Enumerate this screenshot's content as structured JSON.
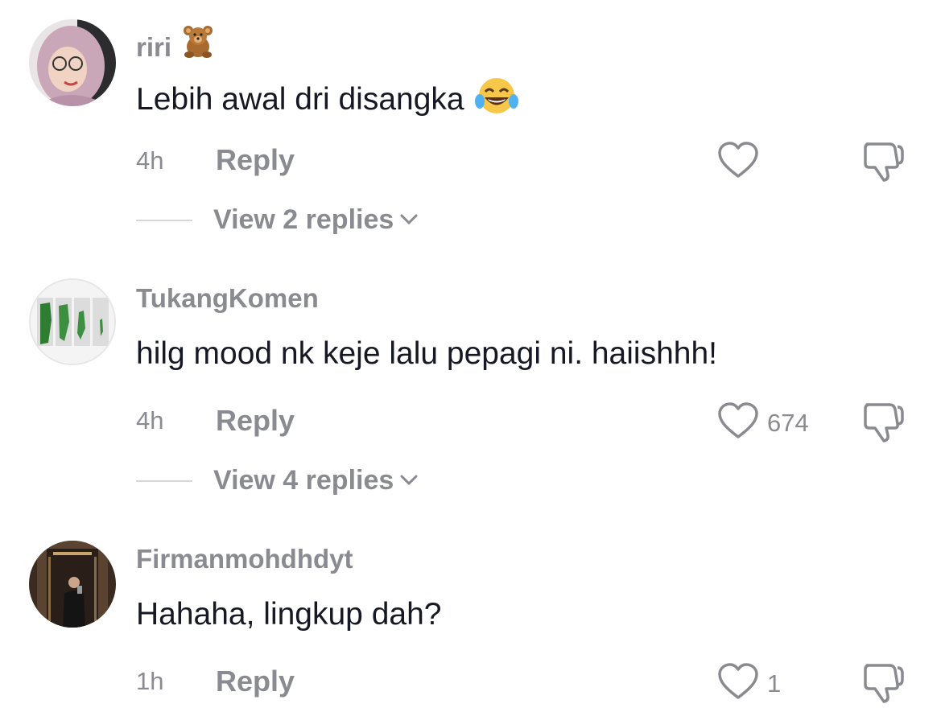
{
  "comments": [
    {
      "username": "riri",
      "username_emoji": "teddy-bear",
      "text": "Lebih awal dri disangka",
      "text_emoji": "face-with-tears-of-joy",
      "time": "4h",
      "reply_label": "Reply",
      "like_count": "",
      "view_replies": "View 2 replies"
    },
    {
      "username": "TukangKomen",
      "text": "hilg mood nk keje lalu pepagi ni. haiishhh!",
      "time": "4h",
      "reply_label": "Reply",
      "like_count": "674",
      "view_replies": "View 4 replies"
    },
    {
      "username": "Firmanmohdhdyt",
      "text": "Hahaha, lingkup dah?",
      "time": "1h",
      "reply_label": "Reply",
      "like_count": "1"
    }
  ],
  "icons": {
    "like": "heart-outline-icon",
    "dislike": "thumbs-down-outline-icon",
    "expand": "chevron-down-icon"
  },
  "colors": {
    "primary_text": "#161823",
    "secondary_text": "#8a8b91",
    "divider": "#d6d7da"
  }
}
